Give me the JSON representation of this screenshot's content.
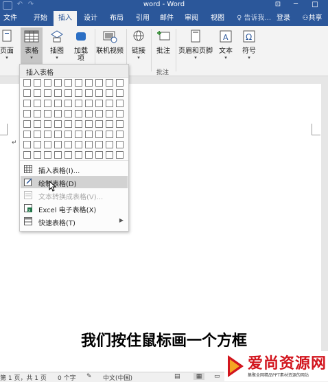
{
  "window": {
    "title": "word - Word"
  },
  "tabs": [
    {
      "label": "文件",
      "active": false
    },
    {
      "label": "开始",
      "active": false
    },
    {
      "label": "插入",
      "active": true
    },
    {
      "label": "设计",
      "active": false
    },
    {
      "label": "布局",
      "active": false
    },
    {
      "label": "引用",
      "active": false
    },
    {
      "label": "邮件",
      "active": false
    },
    {
      "label": "审阅",
      "active": false
    },
    {
      "label": "视图",
      "active": false
    }
  ],
  "tell_me": "告诉我...",
  "sign_in": "登录",
  "share": "共享",
  "ribbon": {
    "buttons": [
      {
        "label": "页面",
        "has_arrow": true
      },
      {
        "label": "表格",
        "has_arrow": true
      },
      {
        "label": "插图",
        "has_arrow": true
      },
      {
        "label": "加载\n项",
        "has_arrow": true
      },
      {
        "label": "联机视频",
        "has_arrow": false
      },
      {
        "label": "链接",
        "has_arrow": true
      },
      {
        "label": "批注",
        "has_arrow": false
      },
      {
        "label": "页眉和页脚",
        "has_arrow": true
      },
      {
        "label": "文本",
        "has_arrow": true
      },
      {
        "label": "符号",
        "has_arrow": true
      }
    ],
    "group_comments": "批注"
  },
  "dropdown": {
    "header": "插入表格",
    "grid": {
      "cols": 10,
      "rows": 8
    },
    "items": [
      {
        "label": "插入表格(I)...",
        "icon": "table-grid-icon",
        "disabled": false,
        "highlighted": false,
        "submenu": false
      },
      {
        "label": "绘制表格(D)",
        "icon": "draw-table-icon",
        "disabled": false,
        "highlighted": true,
        "submenu": false
      },
      {
        "label": "文本转换成表格(V)...",
        "icon": "convert-text-icon",
        "disabled": true,
        "highlighted": false,
        "submenu": false
      },
      {
        "label": "Excel 电子表格(X)",
        "icon": "excel-icon",
        "disabled": false,
        "highlighted": false,
        "submenu": false
      },
      {
        "label": "快速表格(T)",
        "icon": "quick-table-icon",
        "disabled": false,
        "highlighted": false,
        "submenu": true
      }
    ]
  },
  "caption": "我们按住鼠标画一个方框",
  "status": {
    "page": "第 1 页，共 1 页",
    "words": "0 个字",
    "lang": "中文(中国)"
  },
  "watermark": {
    "name": "爱尚资源网",
    "tagline": "集聚全网精品PPT素材资源的网站"
  },
  "colors": {
    "word_blue": "#2b579a",
    "highlight": "#d2d2d2",
    "brand_red": "#d2151e"
  }
}
